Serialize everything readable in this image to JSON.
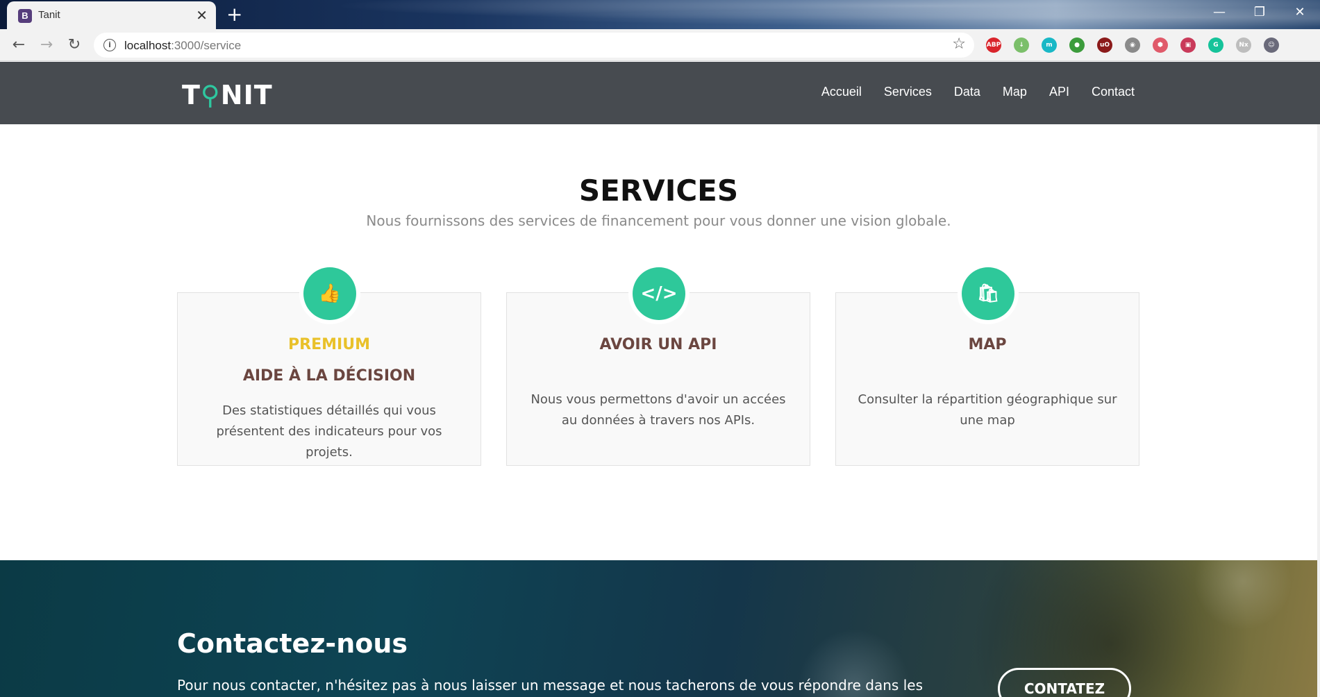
{
  "browser": {
    "tab_favicon": "B",
    "tab_title": "Tanit",
    "tab_close": "✕",
    "new_tab": "+",
    "url_host": "localhost",
    "url_path": ":3000/service",
    "window_controls": [
      "—",
      "❐",
      "✕"
    ],
    "extensions": [
      {
        "name": "adblock-icon",
        "label": "ABP",
        "color": "#d9242b"
      },
      {
        "name": "download-icon",
        "label": "↓",
        "color": "#7bbf6a"
      },
      {
        "name": "m-extension-icon",
        "label": "m",
        "color": "#19b8c6"
      },
      {
        "name": "globe-icon",
        "label": "●",
        "color": "#3c9c3c"
      },
      {
        "name": "ublock-icon",
        "label": "uO",
        "color": "#8b1a1a"
      },
      {
        "name": "eye-icon",
        "label": "◉",
        "color": "#8a8a8a"
      },
      {
        "name": "shield-icon",
        "label": "⬢",
        "color": "#e05a6a"
      },
      {
        "name": "camera-icon",
        "label": "▣",
        "color": "#c93a5a"
      },
      {
        "name": "grammarly-icon",
        "label": "G",
        "color": "#15c39a"
      },
      {
        "name": "nx-icon",
        "label": "Nx",
        "color": "#bdbdbd"
      },
      {
        "name": "profile-avatar-icon",
        "label": "☺",
        "color": "#6a6a7a"
      }
    ]
  },
  "site": {
    "logo_left": "T",
    "logo_accent": "⚲",
    "logo_right": "NIT",
    "nav": [
      "Accueil",
      "Services",
      "Data",
      "Map",
      "API",
      "Contact"
    ]
  },
  "services": {
    "title": "SERVICES",
    "subtitle": "Nous fournissons des services de financement pour vous donner une vision globale.",
    "cards": [
      {
        "icon": "👍",
        "eyebrow": "PREMIUM",
        "title": "AIDE À LA DÉCISION",
        "text": "Des statistiques détaillés qui vous présentent des indicateurs pour vos projets."
      },
      {
        "icon": "</>",
        "eyebrow": "",
        "title": "AVOIR UN API",
        "text": "Nous vous permettons d'avoir un accées au données à travers nos APIs."
      },
      {
        "icon": "🛍",
        "eyebrow": "",
        "title": "MAP",
        "text": "Consulter la répartition géographique sur une map"
      }
    ]
  },
  "contact": {
    "title": "Contactez-nous",
    "text": "Pour nous contacter, n'hésitez pas à nous laisser un message et nous tacherons de vous répondre dans les",
    "button": "CONTATEZ"
  },
  "colors": {
    "navbar": "#474b50",
    "accent_green": "#2ec89a",
    "premium_yellow": "#e9c12a",
    "card_title": "#6b4640"
  }
}
